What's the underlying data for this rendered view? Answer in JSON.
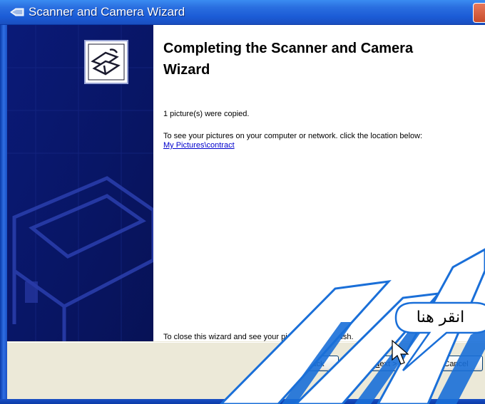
{
  "window": {
    "title": "Scanner and Camera Wizard"
  },
  "main": {
    "heading": "Completing the Scanner and Camera Wizard",
    "copied_text": "1 picture(s) were copied.",
    "instruction_text": "To see your pictures on your computer or network. click the location below:",
    "location_link": "My Pictures\\contract",
    "finish_hint": "To close this wizard and see your pictures, click Finish."
  },
  "buttons": {
    "back_prefix": "< ",
    "back_accel": "B",
    "back_rest": "ack",
    "next_accel": "N",
    "next_rest": "ext >",
    "cancel": "Cancel"
  },
  "callout": {
    "text": "انقر هنا"
  },
  "colors": {
    "titlebar": "#1b5bd6",
    "banner": "#0d1a6d",
    "overlay_stripe": "#1a6fd8",
    "callout_border": "#1a6fd8",
    "link": "#0000cc"
  },
  "icons": {
    "title": "scanner-camera-icon",
    "banner_logo": "scanner-camera-icon"
  }
}
